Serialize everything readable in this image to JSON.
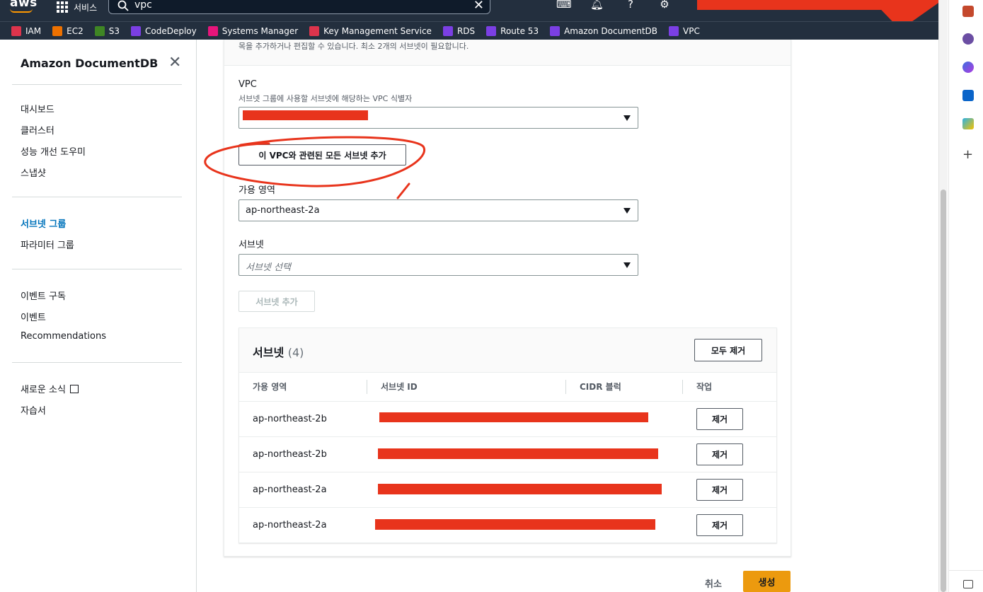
{
  "topnav": {
    "logo": "aws",
    "services_label": "서비스",
    "search_value": "vpc",
    "icons": [
      "cloudshell-icon",
      "bell-icon",
      "help-icon",
      "gear-icon"
    ]
  },
  "bookmarks": [
    {
      "label": "IAM",
      "color": "#dd344c"
    },
    {
      "label": "EC2",
      "color": "#ed7100"
    },
    {
      "label": "S3",
      "color": "#3f8624"
    },
    {
      "label": "CodeDeploy",
      "color": "#7b3fe4"
    },
    {
      "label": "Systems Manager",
      "color": "#e7157b"
    },
    {
      "label": "Key Management Service",
      "color": "#dd344c"
    },
    {
      "label": "RDS",
      "color": "#7b3fe4"
    },
    {
      "label": "Route 53",
      "color": "#7b3fe4"
    },
    {
      "label": "Amazon DocumentDB",
      "color": "#7b3fe4"
    },
    {
      "label": "VPC",
      "color": "#7b3fe4"
    }
  ],
  "sidebar": {
    "title": "Amazon DocumentDB",
    "groups": [
      [
        "대시보드",
        "클러스터",
        "성능 개선 도우미",
        "스냅샷"
      ],
      [
        "서브넷 그룹",
        "파라미터 그룹"
      ],
      [
        "이벤트 구독",
        "이벤트",
        "Recommendations"
      ],
      [
        "새로운 소식",
        "자습서"
      ]
    ],
    "active": "서브넷 그룹"
  },
  "form": {
    "top_description": "목을 추가하거나 편집할 수 있습니다. 최소 2개의 서브넷이 필요합니다.",
    "vpc_label": "VPC",
    "vpc_description": "서브넷 그룹에 사용할 서브넷에 해당하는 VPC 식별자",
    "add_all_button": "이 VPC와 관련된 모든 서브넷 추가",
    "az_label": "가용 영역",
    "az_value": "ap-northeast-2a",
    "subnet_label": "서브넷",
    "subnet_placeholder": "서브넷 선택",
    "add_subnet_button": "서브넷 추가"
  },
  "table": {
    "title": "서브넷",
    "count": "(4)",
    "remove_all": "모두 제거",
    "columns": [
      "가용 영역",
      "서브넷 ID",
      "CIDR 블럭",
      "작업"
    ],
    "rows": [
      {
        "az": "ap-northeast-2b",
        "action": "제거"
      },
      {
        "az": "ap-northeast-2b",
        "action": "제거"
      },
      {
        "az": "ap-northeast-2a",
        "action": "제거"
      },
      {
        "az": "ap-northeast-2a",
        "action": "제거"
      }
    ]
  },
  "footer": {
    "cancel": "취소",
    "create": "생성"
  },
  "colors": {
    "nav_bg": "#232f3e",
    "accent": "#ec9a0e",
    "link": "#0073bb",
    "redaction": "#e8341c"
  }
}
